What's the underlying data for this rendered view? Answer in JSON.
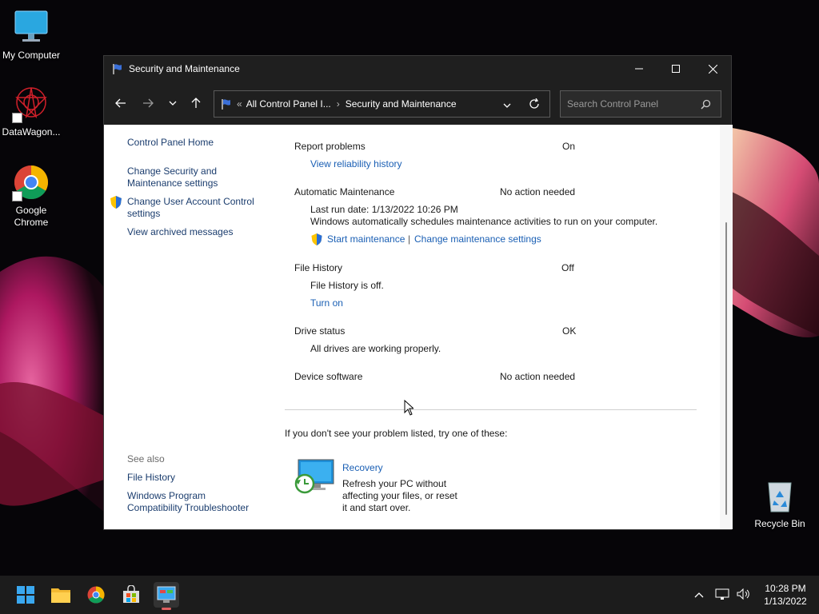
{
  "desktop": {
    "icons": [
      {
        "label": "My Computer"
      },
      {
        "label": "DataWagon..."
      },
      {
        "label": "Google Chrome"
      },
      {
        "label": "Recycle Bin"
      }
    ]
  },
  "window": {
    "title": "Security and Maintenance",
    "address": {
      "overflow": "«",
      "crumb1": "All Control Panel I...",
      "crumb2": "Security and Maintenance"
    },
    "search_placeholder": "Search Control Panel"
  },
  "left_nav": {
    "home": "Control Panel Home",
    "change_security": "Change Security and Maintenance settings",
    "change_uac": "Change User Account Control settings",
    "archived": "View archived messages",
    "see_also": "See also",
    "file_history": "File History",
    "compat": "Windows Program Compatibility Troubleshooter"
  },
  "main": {
    "report_problems": {
      "label": "Report problems",
      "status": "On",
      "link": "View reliability history"
    },
    "auto_maint": {
      "label": "Automatic Maintenance",
      "status": "No action needed",
      "last_run": "Last run date: 1/13/2022 10:26 PM",
      "desc": "Windows automatically schedules maintenance activities to run on your computer.",
      "start": "Start maintenance",
      "separator": "|",
      "change": "Change maintenance settings"
    },
    "file_history": {
      "label": "File History",
      "status": "Off",
      "desc": "File History is off.",
      "link": "Turn on"
    },
    "drive_status": {
      "label": "Drive status",
      "status": "OK",
      "desc": "All drives are working properly."
    },
    "device_software": {
      "label": "Device software",
      "status": "No action needed"
    },
    "try_these": "If you don't see your problem listed, try one of these:",
    "recovery": {
      "title": "Recovery",
      "desc1": "Refresh your PC without",
      "desc2": "affecting your files, or reset",
      "desc3": "it and start over."
    }
  },
  "taskbar": {
    "time": "10:28 PM",
    "date": "1/13/2022"
  },
  "colors": {
    "link": "#1a5fb4",
    "titlebar": "#1f1f1f",
    "taskbar": "#1c1c1c"
  }
}
